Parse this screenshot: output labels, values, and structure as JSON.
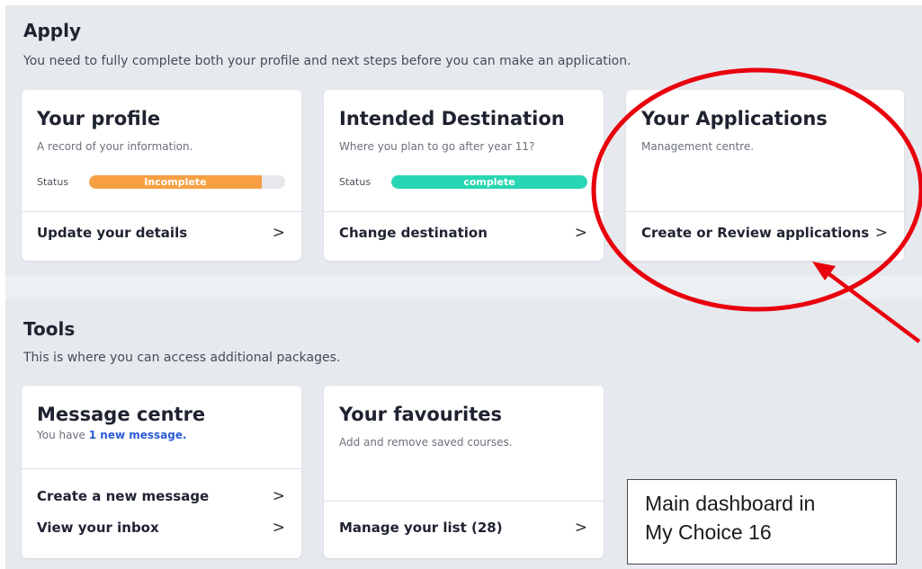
{
  "apply": {
    "title": "Apply",
    "subtitle": "You need to fully complete both your profile and next steps before you can make an application.",
    "cards": [
      {
        "title": "Your profile",
        "subtitle": "A record of your information.",
        "status_label": "Status",
        "status_text": "Incomplete",
        "status_progress_fraction": 0.88,
        "status_color": "#f7a043",
        "link_label": "Update your details"
      },
      {
        "title": "Intended Destination",
        "subtitle": "Where you plan to go after year 11?",
        "status_label": "Status",
        "status_text": "complete",
        "status_progress_fraction": 1.0,
        "status_color": "#28d6b3",
        "link_label": "Change destination"
      },
      {
        "title": "Your Applications",
        "subtitle": "Management centre.",
        "link_label": "Create or Review applications"
      }
    ]
  },
  "tools": {
    "title": "Tools",
    "subtitle": "This is where you can access additional packages.",
    "cards": [
      {
        "title": "Message centre",
        "message_prefix": "You have ",
        "message_highlight": "1 new message.",
        "links": [
          "Create a new message",
          "View your inbox"
        ]
      },
      {
        "title": "Your favourites",
        "subtitle": "Add and remove saved courses.",
        "link_label": "Manage your list (28)"
      }
    ]
  },
  "annotation": {
    "line1": "Main dashboard in",
    "line2": "My Choice 16",
    "highlight_color": "#e8000d"
  },
  "colors": {
    "section_bg": "#e6e9ee",
    "card_bg": "#ffffff",
    "link_blue": "#2a5bd7"
  },
  "icons": {
    "chevron": "chevron-right-icon",
    "chevron_glyph": ">"
  }
}
